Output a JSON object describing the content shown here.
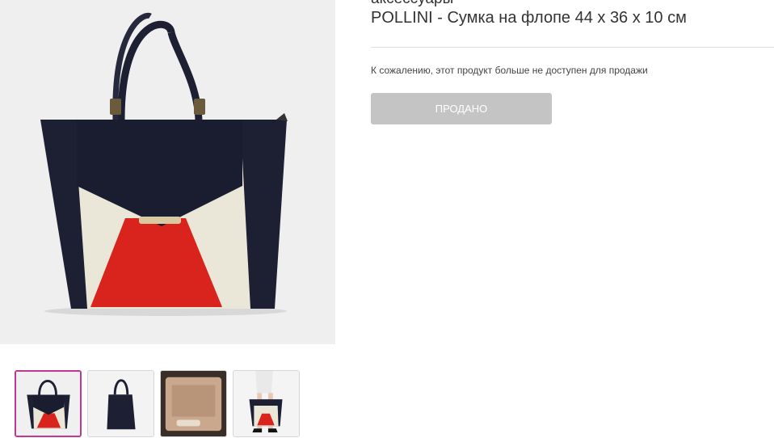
{
  "product": {
    "category": "аксессуары",
    "title": "POLLINI - Сумка на флопе 44 x 36 x 10 см",
    "unavailable_notice": "К сожалению, этот продукт больше не доступен для продажи",
    "sold_label": "ПРОДАНО"
  },
  "gallery": {
    "main_image": "handbag-front-image",
    "thumbnails": [
      {
        "name": "handbag-front-thumbnail",
        "active": true
      },
      {
        "name": "handbag-back-thumbnail",
        "active": false
      },
      {
        "name": "handbag-interior-thumbnail",
        "active": false
      },
      {
        "name": "handbag-model-thumbnail",
        "active": false
      }
    ]
  },
  "colors": {
    "accent": "#c0388f",
    "sold_button_bg": "#c4c4c4",
    "bag_navy": "#1d1f33",
    "bag_cream": "#ebe7d8",
    "bag_red": "#d8241c"
  }
}
